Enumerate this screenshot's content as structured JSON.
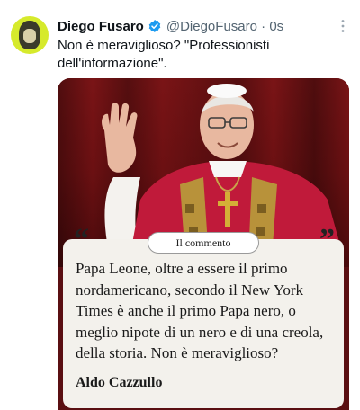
{
  "tweet": {
    "author_name": "Diego Fusaro",
    "author_handle": "@DiegoFusaro",
    "separator": "·",
    "time": "0s",
    "text": "Non è meraviglioso? \"Professionisti dell'informazione\".",
    "verified_color": "#1d9bf0"
  },
  "media": {
    "tag": "Il commento",
    "quote": "Papa Leone, oltre a essere il primo nordamericano, secondo il New York Times è anche il primo Papa nero, o meglio nipote di un nero e di una creola, della storia. Non è meraviglioso?",
    "author": "Aldo Cazzullo",
    "open_quote": "“",
    "close_quote": "”"
  },
  "icons": {
    "more": "more-vertical-icon",
    "verified": "verified-badge-icon"
  }
}
